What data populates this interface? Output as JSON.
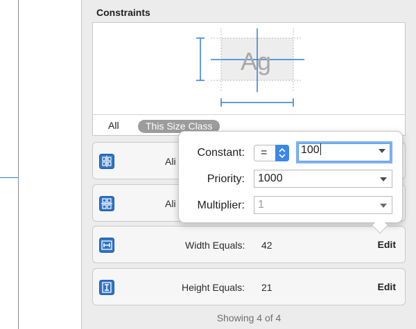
{
  "inspector": {
    "section_title": "Constraints",
    "preview_text": "Ag",
    "filters": {
      "all": "All",
      "size_class": "This Size Class"
    },
    "constraints": [
      {
        "label": "Ali",
        "value": "",
        "edit": "",
        "icon": "align-horizontal-centers-icon"
      },
      {
        "label": "Ali",
        "value": "",
        "edit": "",
        "icon": "align-vertical-centers-icon"
      },
      {
        "label": "Width Equals:",
        "value": "42",
        "edit": "Edit",
        "icon": "width-constraint-icon"
      },
      {
        "label": "Height Equals:",
        "value": "21",
        "edit": "Edit",
        "icon": "height-constraint-icon"
      }
    ],
    "showing": "Showing 4 of 4"
  },
  "popover": {
    "constant_label": "Constant:",
    "relation": "=",
    "constant_value": "100",
    "priority_label": "Priority:",
    "priority_value": "1000",
    "multiplier_label": "Multiplier:",
    "multiplier_value": "1"
  },
  "colors": {
    "accent": "#2a7fd6",
    "stepper": "#3d88e6",
    "focus_ring": "#7fb2ef",
    "inspector_bg": "#ececec",
    "filter_pill": "#9c9c9c"
  }
}
